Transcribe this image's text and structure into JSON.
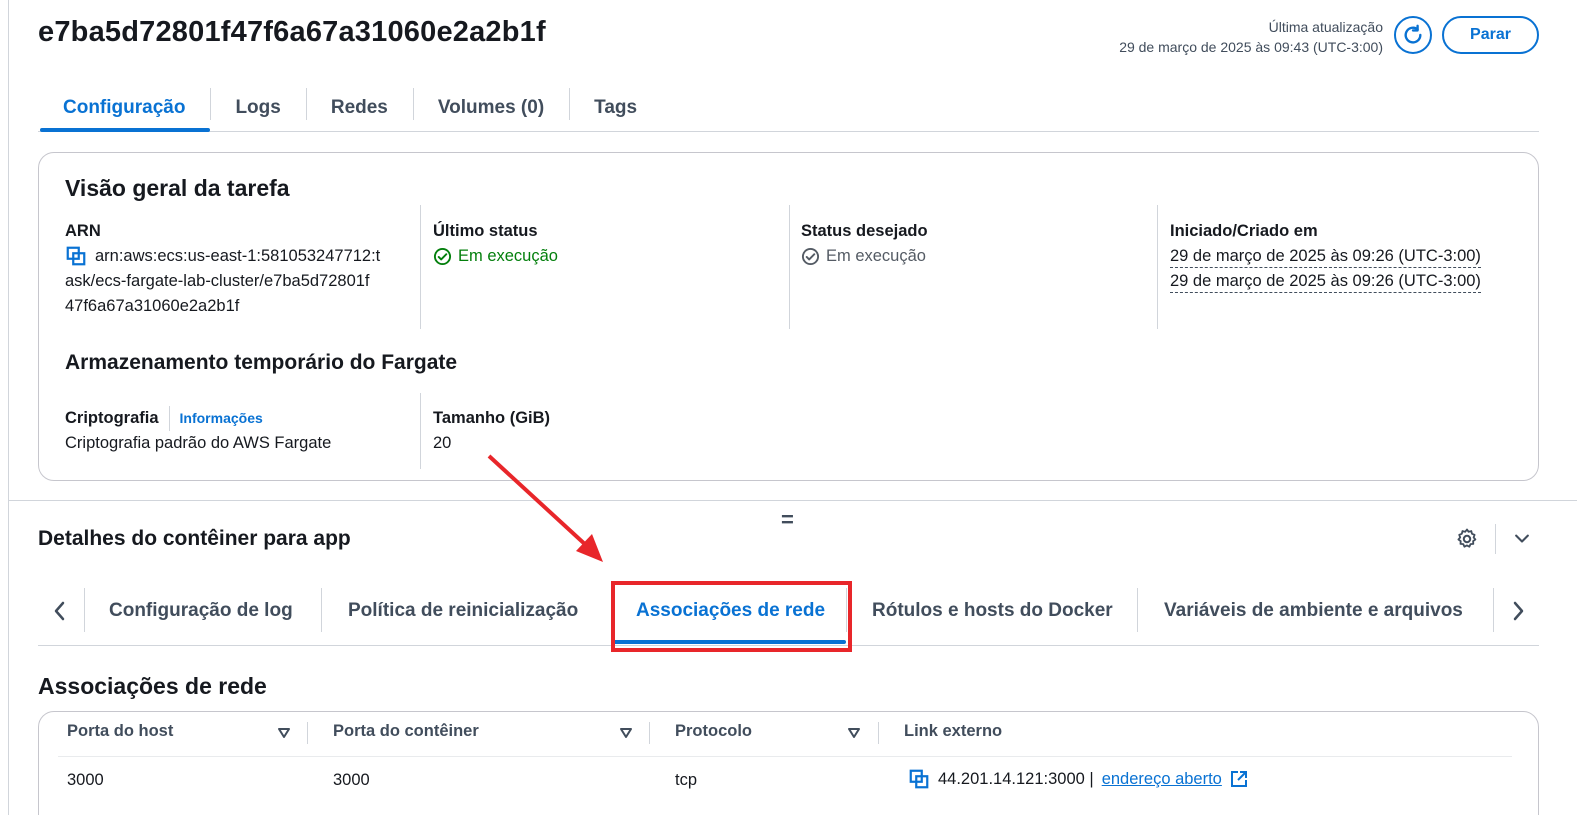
{
  "header": {
    "task_id": "e7ba5d72801f47f6a67a31060e2a2b1f",
    "last_updated_label": "Última atualização",
    "last_updated_value": "29 de março de 2025 às 09:43 (UTC-3:00)",
    "stop_label": "Parar"
  },
  "tabs": [
    {
      "label": "Configuração",
      "active": true
    },
    {
      "label": "Logs",
      "active": false
    },
    {
      "label": "Redes",
      "active": false
    },
    {
      "label": "Volumes (0)",
      "active": false
    },
    {
      "label": "Tags",
      "active": false
    }
  ],
  "overview": {
    "title": "Visão geral da tarefa",
    "arn_label": "ARN",
    "arn_line1": "arn:aws:ecs:us-east-1:581053247712:t",
    "arn_line2": "ask/ecs-fargate-lab-cluster/e7ba5d72801f",
    "arn_line3": "47f6a67a31060e2a2b1f",
    "last_status_label": "Último status",
    "last_status_value": "Em execução",
    "desired_status_label": "Status desejado",
    "desired_status_value": "Em execução",
    "started_label": "Iniciado/Criado em",
    "started_value": "29 de março de 2025 às 09:26 (UTC-3:00)",
    "created_value": "29 de março de 2025 às 09:26 (UTC-3:00)",
    "storage_title": "Armazenamento temporário do Fargate",
    "encryption_label": "Criptografia",
    "info_link": "Informações",
    "encryption_value": "Criptografia padrão do AWS Fargate",
    "size_label": "Tamanho (GiB)",
    "size_value": "20"
  },
  "container": {
    "title": "Detalhes do contêiner para app",
    "handle": "=",
    "tabs": [
      {
        "label": "Configuração de log",
        "active": false
      },
      {
        "label": "Política de reinicialização",
        "active": false
      },
      {
        "label": "Associações de rede",
        "active": true
      },
      {
        "label": "Rótulos e hosts do Docker",
        "active": false
      },
      {
        "label": "Variáveis de ambiente e arquivos",
        "active": false
      }
    ]
  },
  "network_bindings": {
    "title": "Associações de rede",
    "columns": [
      "Porta do host",
      "Porta do contêiner",
      "Protocolo",
      "Link externo"
    ],
    "rows": [
      {
        "host_port": "3000",
        "container_port": "3000",
        "protocol": "tcp",
        "external_link": "44.201.14.121:3000 |",
        "open_link": "endereço aberto"
      }
    ]
  },
  "colors": {
    "accent": "#0972d3",
    "success": "#037f0c",
    "highlight": "#e8262a"
  }
}
